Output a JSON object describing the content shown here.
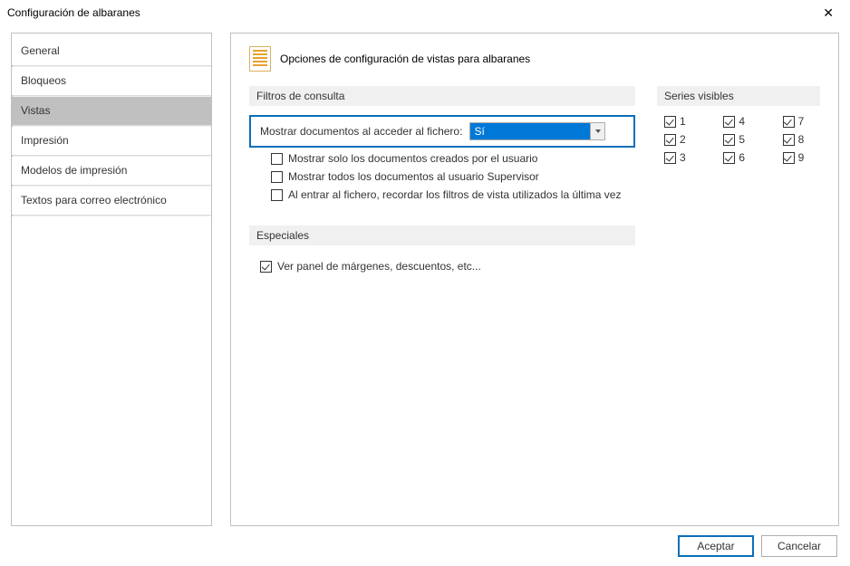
{
  "window": {
    "title": "Configuración de albaranes"
  },
  "sidebar": {
    "items": [
      {
        "label": "General",
        "active": false
      },
      {
        "label": "Bloqueos",
        "active": false
      },
      {
        "label": "Vistas",
        "active": true
      },
      {
        "label": "Impresión",
        "active": false
      },
      {
        "label": "Modelos de impresión",
        "active": false
      },
      {
        "label": "Textos para correo electrónico",
        "active": false
      }
    ]
  },
  "panel": {
    "title": "Opciones de configuración de vistas para albaranes"
  },
  "filters": {
    "heading": "Filtros de consulta",
    "dropdown_label": "Mostrar documentos al acceder al fichero:",
    "dropdown_value": "Sí",
    "checks": [
      {
        "label": "Mostrar solo los documentos creados por el usuario",
        "checked": false
      },
      {
        "label": "Mostrar todos los documentos al usuario Supervisor",
        "checked": false
      },
      {
        "label": "Al entrar al fichero, recordar los filtros de vista utilizados la última vez",
        "checked": false
      }
    ]
  },
  "series": {
    "heading": "Series visibles",
    "items": [
      {
        "label": "1",
        "checked": true
      },
      {
        "label": "4",
        "checked": true
      },
      {
        "label": "7",
        "checked": true
      },
      {
        "label": "2",
        "checked": true
      },
      {
        "label": "5",
        "checked": true
      },
      {
        "label": "8",
        "checked": true
      },
      {
        "label": "3",
        "checked": true
      },
      {
        "label": "6",
        "checked": true
      },
      {
        "label": "9",
        "checked": true
      }
    ]
  },
  "specials": {
    "heading": "Especiales",
    "checks": [
      {
        "label": "Ver panel de márgenes, descuentos, etc...",
        "checked": true
      }
    ]
  },
  "footer": {
    "accept": "Aceptar",
    "cancel": "Cancelar"
  }
}
